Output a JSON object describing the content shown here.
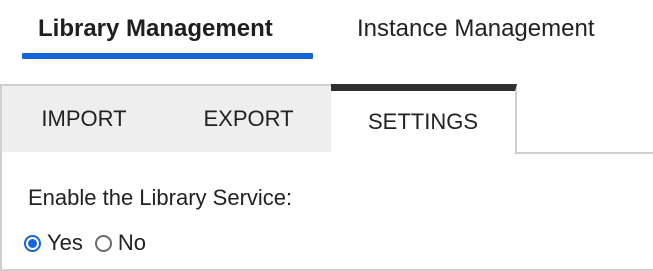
{
  "top_tabs": [
    {
      "label": "Library Management",
      "selected": true
    },
    {
      "label": "Instance Management",
      "selected": false
    }
  ],
  "sub_tabs": [
    {
      "label": "IMPORT",
      "selected": false
    },
    {
      "label": "EXPORT",
      "selected": false
    },
    {
      "label": "SETTINGS",
      "selected": true
    }
  ],
  "settings": {
    "library_service": {
      "label": "Enable the Library Service:",
      "selected_value": "Yes",
      "options": [
        {
          "label": "Yes",
          "selected": true
        },
        {
          "label": "No",
          "selected": false
        }
      ]
    }
  },
  "colors": {
    "accent": "#1565d8",
    "active_subtab_border": "#2f2f2f",
    "inactive_subtab_bg": "#eeeeee",
    "border": "#cfcfcf"
  }
}
